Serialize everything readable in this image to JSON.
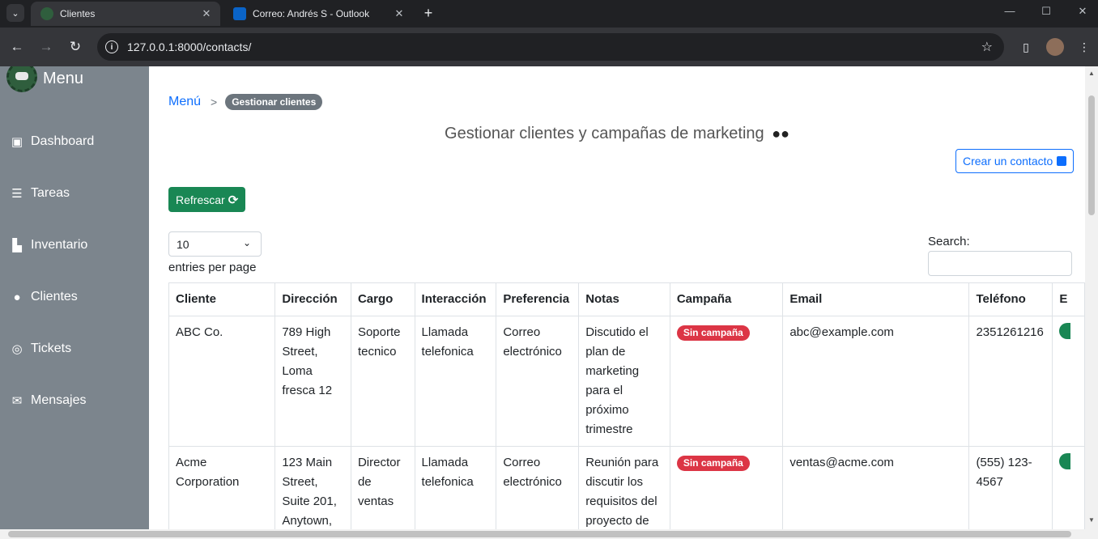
{
  "browser": {
    "tabs": [
      {
        "title": "Clientes",
        "active": true
      },
      {
        "title": "Correo: Andrés S - Outlook",
        "active": false
      }
    ],
    "url": "127.0.0.1:8000/contacts/"
  },
  "sidebar": {
    "brand": "Menu",
    "items": [
      {
        "label": "Dashboard",
        "icon": "dashboard-icon"
      },
      {
        "label": "Tareas",
        "icon": "tasks-icon"
      },
      {
        "label": "Inventario",
        "icon": "inventory-icon"
      },
      {
        "label": "Clientes",
        "icon": "users-icon"
      },
      {
        "label": "Tickets",
        "icon": "headset-icon"
      },
      {
        "label": "Mensajes",
        "icon": "envelope-icon"
      }
    ]
  },
  "breadcrumb": {
    "home": "Menú",
    "separator": ">",
    "current": "Gestionar clientes"
  },
  "page": {
    "title": "Gestionar clientes y campañas de marketing",
    "create_button": "Crear un contacto",
    "refresh_button": "Refrescar",
    "per_page_value": "10",
    "per_page_label": "entries per page",
    "search_label": "Search:"
  },
  "table": {
    "headers": [
      "Cliente",
      "Dirección",
      "Cargo",
      "Interacción",
      "Preferencia",
      "Notas",
      "Campaña",
      "Email",
      "Teléfono",
      "E"
    ],
    "rows": [
      {
        "cliente": "ABC Co.",
        "direccion": "789 High Street, Loma fresca 12",
        "cargo": "Soporte tecnico",
        "interaccion": "Llamada telefonica",
        "preferencia": "Correo electrónico",
        "notas": "Discutido el plan de marketing para el próximo trimestre",
        "campana": "Sin campaña",
        "email": "abc@example.com",
        "telefono": "2351261216"
      },
      {
        "cliente": "Acme Corporation",
        "direccion": "123 Main Street, Suite 201, Anytown,",
        "cargo": "Director de ventas",
        "interaccion": "Llamada telefonica",
        "preferencia": "Correo electrónico",
        "notas": "Reunión para discutir los requisitos del proyecto de",
        "campana": "Sin campaña",
        "email": "ventas@acme.com",
        "telefono": "(555) 123-4567"
      }
    ]
  },
  "colors": {
    "sidebar": "#7c858d",
    "primary": "#0d6efd",
    "success": "#198754",
    "danger": "#dc3545"
  }
}
